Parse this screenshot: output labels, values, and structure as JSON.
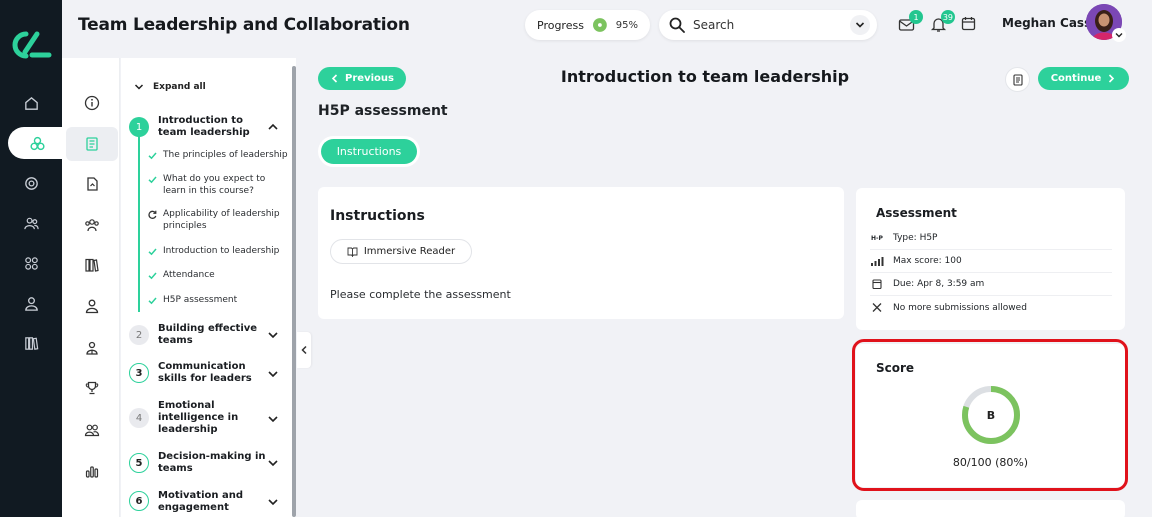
{
  "app": {
    "title": "Team Leadership and Collaboration"
  },
  "header": {
    "progress_label": "Progress",
    "progress_value": "95%",
    "progress_fraction": 0.95,
    "search_placeholder": "Search",
    "messages_badge": "1",
    "notifications_badge": "39",
    "user_name": "Meghan Cass"
  },
  "outline": {
    "expand_all": "Expand all",
    "sections": [
      {
        "number": "1",
        "title": "Introduction to team leadership",
        "state": "current",
        "expanded": true,
        "lessons": [
          {
            "title": "The principles of leadership",
            "status": "done"
          },
          {
            "title": "What do you expect to learn in this course?",
            "status": "done"
          },
          {
            "title": "Applicability of leadership principles",
            "status": "in-progress"
          },
          {
            "title": "Introduction to leadership",
            "status": "done"
          },
          {
            "title": "Attendance",
            "status": "done"
          },
          {
            "title": "H5P assessment",
            "status": "done"
          }
        ]
      },
      {
        "number": "2",
        "title": "Building effective teams",
        "state": "locked"
      },
      {
        "number": "3",
        "title": "Communication skills for leaders",
        "state": "open"
      },
      {
        "number": "4",
        "title": "Emotional intelligence in leadership",
        "state": "locked"
      },
      {
        "number": "5",
        "title": "Decision-making in teams",
        "state": "open"
      },
      {
        "number": "6",
        "title": "Motivation and engagement",
        "state": "open"
      }
    ]
  },
  "main": {
    "previous_label": "Previous",
    "continue_label": "Continue",
    "lesson_title": "Introduction to team leadership",
    "page_heading": "H5P assessment",
    "tab_label": "Instructions",
    "instructions": {
      "heading": "Instructions",
      "reader_label": "Immersive Reader",
      "text": "Please complete the assessment"
    },
    "assessment": {
      "heading": "Assessment",
      "type_icon": "H-P",
      "type": "Type: H5P",
      "max_score": "Max score: 100",
      "due": "Due: Apr 8, 3:59 am",
      "submissions": "No more submissions allowed"
    },
    "score": {
      "heading": "Score",
      "grade": "B",
      "value": "80/100 (80%)",
      "fraction": 0.8
    }
  },
  "colors": {
    "accent": "#2dd19b",
    "rail": "#111a22",
    "highlight": "#e0121b",
    "score_ring": "#7cc35f"
  }
}
